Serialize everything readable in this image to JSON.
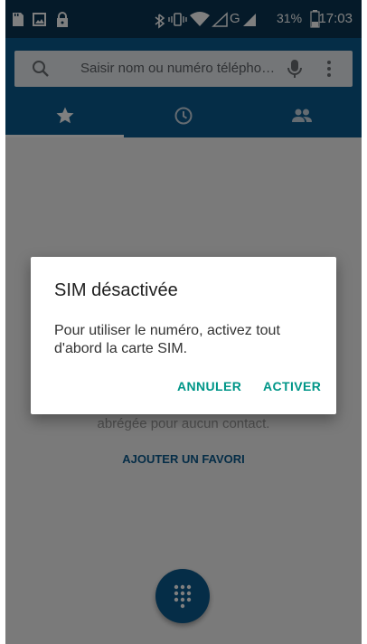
{
  "status_bar": {
    "time": "17:03",
    "battery_percent": "31%",
    "network": "G",
    "icons": [
      "sd-card-icon",
      "image-icon",
      "lock-icon",
      "bluetooth-icon",
      "vibrate-icon",
      "wifi-icon",
      "signal-icon",
      "battery-icon"
    ]
  },
  "search": {
    "placeholder": "Saisir nom ou numéro télépho…"
  },
  "tabs": [
    {
      "name": "favorites",
      "icon": "star-icon",
      "selected": true
    },
    {
      "name": "recents",
      "icon": "clock-icon",
      "selected": false
    },
    {
      "name": "contacts",
      "icon": "people-icon",
      "selected": false
    }
  ],
  "content": {
    "empty_text": "abrégée pour aucun contact.",
    "add_favorite": "AJOUTER UN FAVORI"
  },
  "dialog": {
    "title": "SIM désactivée",
    "message": "Pour utiliser le numéro, activez tout d'abord la carte SIM.",
    "cancel": "ANNULER",
    "confirm": "ACTIVER"
  },
  "colors": {
    "status_bar": "#0a3552",
    "primary": "#0b5a8e",
    "dialog_button": "#009688"
  }
}
